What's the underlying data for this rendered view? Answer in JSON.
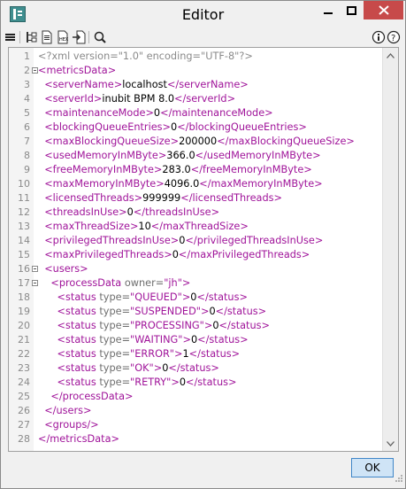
{
  "window": {
    "title": "Editor",
    "colors": {
      "close_button": "#c74a4a",
      "ok_border": "#3f86c8"
    }
  },
  "toolbar": {
    "icons": [
      "menu-icon",
      "tree-icon",
      "document-icon",
      "hex-icon",
      "import-icon",
      "search-icon",
      "info-icon",
      "help-icon"
    ]
  },
  "editor": {
    "lines": [
      {
        "n": "1",
        "parts": [
          {
            "c": "decl",
            "t": "<?xml version=\"1.0\" encoding=\"UTF-8\"?>"
          }
        ]
      },
      {
        "n": "2",
        "fold": true,
        "parts": [
          {
            "c": "t",
            "t": "<metricsData>"
          }
        ]
      },
      {
        "n": "3",
        "parts": [
          {
            "c": "txt",
            "t": "  "
          },
          {
            "c": "t",
            "t": "<serverName>"
          },
          {
            "c": "txt",
            "t": "localhost"
          },
          {
            "c": "t",
            "t": "</serverName>"
          }
        ]
      },
      {
        "n": "4",
        "parts": [
          {
            "c": "txt",
            "t": "  "
          },
          {
            "c": "t",
            "t": "<serverId>"
          },
          {
            "c": "txt",
            "t": "inubit BPM 8.0"
          },
          {
            "c": "t",
            "t": "</serverId>"
          }
        ]
      },
      {
        "n": "5",
        "parts": [
          {
            "c": "txt",
            "t": "  "
          },
          {
            "c": "t",
            "t": "<maintenanceMode>"
          },
          {
            "c": "txt",
            "t": "0"
          },
          {
            "c": "t",
            "t": "</maintenanceMode>"
          }
        ]
      },
      {
        "n": "6",
        "parts": [
          {
            "c": "txt",
            "t": "  "
          },
          {
            "c": "t",
            "t": "<blockingQueueEntries>"
          },
          {
            "c": "txt",
            "t": "0"
          },
          {
            "c": "t",
            "t": "</blockingQueueEntries>"
          }
        ]
      },
      {
        "n": "7",
        "parts": [
          {
            "c": "txt",
            "t": "  "
          },
          {
            "c": "t",
            "t": "<maxBlockingQueueSize>"
          },
          {
            "c": "txt",
            "t": "200000"
          },
          {
            "c": "t",
            "t": "</maxBlockingQueueSize>"
          }
        ]
      },
      {
        "n": "8",
        "parts": [
          {
            "c": "txt",
            "t": "  "
          },
          {
            "c": "t",
            "t": "<usedMemoryInMByte>"
          },
          {
            "c": "txt",
            "t": "366.0"
          },
          {
            "c": "t",
            "t": "</usedMemoryInMByte>"
          }
        ]
      },
      {
        "n": "9",
        "parts": [
          {
            "c": "txt",
            "t": "  "
          },
          {
            "c": "t",
            "t": "<freeMemoryInMByte>"
          },
          {
            "c": "txt",
            "t": "283.0"
          },
          {
            "c": "t",
            "t": "</freeMemoryInMByte>"
          }
        ]
      },
      {
        "n": "10",
        "parts": [
          {
            "c": "txt",
            "t": "  "
          },
          {
            "c": "t",
            "t": "<maxMemoryInMByte>"
          },
          {
            "c": "txt",
            "t": "4096.0"
          },
          {
            "c": "t",
            "t": "</maxMemoryInMByte>"
          }
        ]
      },
      {
        "n": "11",
        "parts": [
          {
            "c": "txt",
            "t": "  "
          },
          {
            "c": "t",
            "t": "<licensedThreads>"
          },
          {
            "c": "txt",
            "t": "999999"
          },
          {
            "c": "t",
            "t": "</licensedThreads>"
          }
        ]
      },
      {
        "n": "12",
        "parts": [
          {
            "c": "txt",
            "t": "  "
          },
          {
            "c": "t",
            "t": "<threadsInUse>"
          },
          {
            "c": "txt",
            "t": "0"
          },
          {
            "c": "t",
            "t": "</threadsInUse>"
          }
        ]
      },
      {
        "n": "13",
        "parts": [
          {
            "c": "txt",
            "t": "  "
          },
          {
            "c": "t",
            "t": "<maxThreadSize>"
          },
          {
            "c": "txt",
            "t": "10"
          },
          {
            "c": "t",
            "t": "</maxThreadSize>"
          }
        ]
      },
      {
        "n": "14",
        "parts": [
          {
            "c": "txt",
            "t": "  "
          },
          {
            "c": "t",
            "t": "<privilegedThreadsInUse>"
          },
          {
            "c": "txt",
            "t": "0"
          },
          {
            "c": "t",
            "t": "</privilegedThreadsInUse>"
          }
        ]
      },
      {
        "n": "15",
        "parts": [
          {
            "c": "txt",
            "t": "  "
          },
          {
            "c": "t",
            "t": "<maxPrivilegedThreads>"
          },
          {
            "c": "txt",
            "t": "0"
          },
          {
            "c": "t",
            "t": "</maxPrivilegedThreads>"
          }
        ]
      },
      {
        "n": "16",
        "fold": true,
        "parts": [
          {
            "c": "txt",
            "t": "  "
          },
          {
            "c": "t",
            "t": "<users>"
          }
        ]
      },
      {
        "n": "17",
        "fold": true,
        "parts": [
          {
            "c": "txt",
            "t": "    "
          },
          {
            "c": "t",
            "t": "<processData "
          },
          {
            "c": "attr",
            "t": "owner="
          },
          {
            "c": "val",
            "t": "\"jh\""
          },
          {
            "c": "t",
            "t": ">"
          }
        ]
      },
      {
        "n": "18",
        "parts": [
          {
            "c": "txt",
            "t": "      "
          },
          {
            "c": "t",
            "t": "<status "
          },
          {
            "c": "attr",
            "t": "type="
          },
          {
            "c": "val",
            "t": "\"QUEUED\""
          },
          {
            "c": "t",
            "t": ">"
          },
          {
            "c": "txt",
            "t": "0"
          },
          {
            "c": "t",
            "t": "</status>"
          }
        ]
      },
      {
        "n": "19",
        "parts": [
          {
            "c": "txt",
            "t": "      "
          },
          {
            "c": "t",
            "t": "<status "
          },
          {
            "c": "attr",
            "t": "type="
          },
          {
            "c": "val",
            "t": "\"SUSPENDED\""
          },
          {
            "c": "t",
            "t": ">"
          },
          {
            "c": "txt",
            "t": "0"
          },
          {
            "c": "t",
            "t": "</status>"
          }
        ]
      },
      {
        "n": "20",
        "parts": [
          {
            "c": "txt",
            "t": "      "
          },
          {
            "c": "t",
            "t": "<status "
          },
          {
            "c": "attr",
            "t": "type="
          },
          {
            "c": "val",
            "t": "\"PROCESSING\""
          },
          {
            "c": "t",
            "t": ">"
          },
          {
            "c": "txt",
            "t": "0"
          },
          {
            "c": "t",
            "t": "</status>"
          }
        ]
      },
      {
        "n": "21",
        "parts": [
          {
            "c": "txt",
            "t": "      "
          },
          {
            "c": "t",
            "t": "<status "
          },
          {
            "c": "attr",
            "t": "type="
          },
          {
            "c": "val",
            "t": "\"WAITING\""
          },
          {
            "c": "t",
            "t": ">"
          },
          {
            "c": "txt",
            "t": "0"
          },
          {
            "c": "t",
            "t": "</status>"
          }
        ]
      },
      {
        "n": "22",
        "parts": [
          {
            "c": "txt",
            "t": "      "
          },
          {
            "c": "t",
            "t": "<status "
          },
          {
            "c": "attr",
            "t": "type="
          },
          {
            "c": "val",
            "t": "\"ERROR\""
          },
          {
            "c": "t",
            "t": ">"
          },
          {
            "c": "txt",
            "t": "1"
          },
          {
            "c": "t",
            "t": "</status>"
          }
        ]
      },
      {
        "n": "23",
        "parts": [
          {
            "c": "txt",
            "t": "      "
          },
          {
            "c": "t",
            "t": "<status "
          },
          {
            "c": "attr",
            "t": "type="
          },
          {
            "c": "val",
            "t": "\"OK\""
          },
          {
            "c": "t",
            "t": ">"
          },
          {
            "c": "txt",
            "t": "0"
          },
          {
            "c": "t",
            "t": "</status>"
          }
        ]
      },
      {
        "n": "24",
        "parts": [
          {
            "c": "txt",
            "t": "      "
          },
          {
            "c": "t",
            "t": "<status "
          },
          {
            "c": "attr",
            "t": "type="
          },
          {
            "c": "val",
            "t": "\"RETRY\""
          },
          {
            "c": "t",
            "t": ">"
          },
          {
            "c": "txt",
            "t": "0"
          },
          {
            "c": "t",
            "t": "</status>"
          }
        ]
      },
      {
        "n": "25",
        "parts": [
          {
            "c": "txt",
            "t": "    "
          },
          {
            "c": "t",
            "t": "</processData>"
          }
        ]
      },
      {
        "n": "26",
        "parts": [
          {
            "c": "txt",
            "t": "  "
          },
          {
            "c": "t",
            "t": "</users>"
          }
        ]
      },
      {
        "n": "27",
        "parts": [
          {
            "c": "txt",
            "t": "  "
          },
          {
            "c": "t",
            "t": "<groups/>"
          }
        ]
      },
      {
        "n": "28",
        "parts": [
          {
            "c": "t",
            "t": "</metricsData>"
          }
        ]
      }
    ]
  },
  "footer": {
    "ok_label": "OK"
  }
}
